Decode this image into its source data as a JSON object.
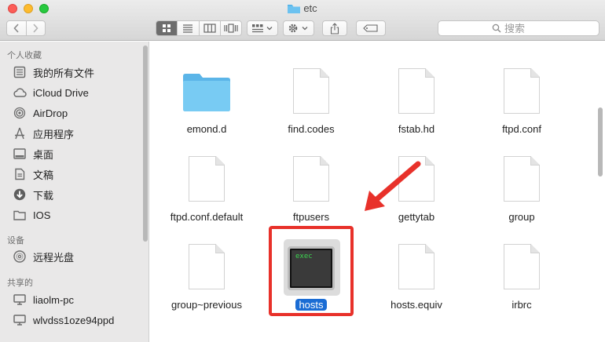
{
  "window": {
    "title": "etc"
  },
  "toolbar": {
    "back_label": "‹",
    "forward_label": "›",
    "search_placeholder": "搜索"
  },
  "sidebar": {
    "sections": [
      {
        "heading": "个人收藏",
        "items": [
          {
            "label": "我的所有文件",
            "icon": "all-files-icon"
          },
          {
            "label": "iCloud Drive",
            "icon": "cloud-icon"
          },
          {
            "label": "AirDrop",
            "icon": "airdrop-icon"
          },
          {
            "label": "应用程序",
            "icon": "applications-icon"
          },
          {
            "label": "桌面",
            "icon": "desktop-icon"
          },
          {
            "label": "文稿",
            "icon": "documents-icon"
          },
          {
            "label": "下载",
            "icon": "downloads-icon"
          },
          {
            "label": "IOS",
            "icon": "folder-icon"
          }
        ]
      },
      {
        "heading": "设备",
        "items": [
          {
            "label": "远程光盘",
            "icon": "disc-icon"
          }
        ]
      },
      {
        "heading": "共享的",
        "items": [
          {
            "label": "liaolm-pc",
            "icon": "computer-icon"
          },
          {
            "label": "wlvdss1oze94ppd",
            "icon": "computer-icon"
          }
        ]
      }
    ]
  },
  "files": [
    {
      "name": "emond.d",
      "kind": "folder"
    },
    {
      "name": "find.codes",
      "kind": "document"
    },
    {
      "name": "fstab.hd",
      "kind": "document"
    },
    {
      "name": "ftpd.conf",
      "kind": "document"
    },
    {
      "name": "ftpd.conf.default",
      "kind": "document"
    },
    {
      "name": "ftpusers",
      "kind": "document"
    },
    {
      "name": "gettytab",
      "kind": "document"
    },
    {
      "name": "group",
      "kind": "document"
    },
    {
      "name": "group~previous",
      "kind": "document"
    },
    {
      "name": "hosts",
      "kind": "executable",
      "selected": true,
      "icon_text": "exec"
    },
    {
      "name": "hosts.equiv",
      "kind": "document"
    },
    {
      "name": "irbrc",
      "kind": "document"
    }
  ],
  "colors": {
    "selection": "#1a6cd4",
    "annotation": "#e8312a",
    "folder": "#6cc2f0"
  }
}
